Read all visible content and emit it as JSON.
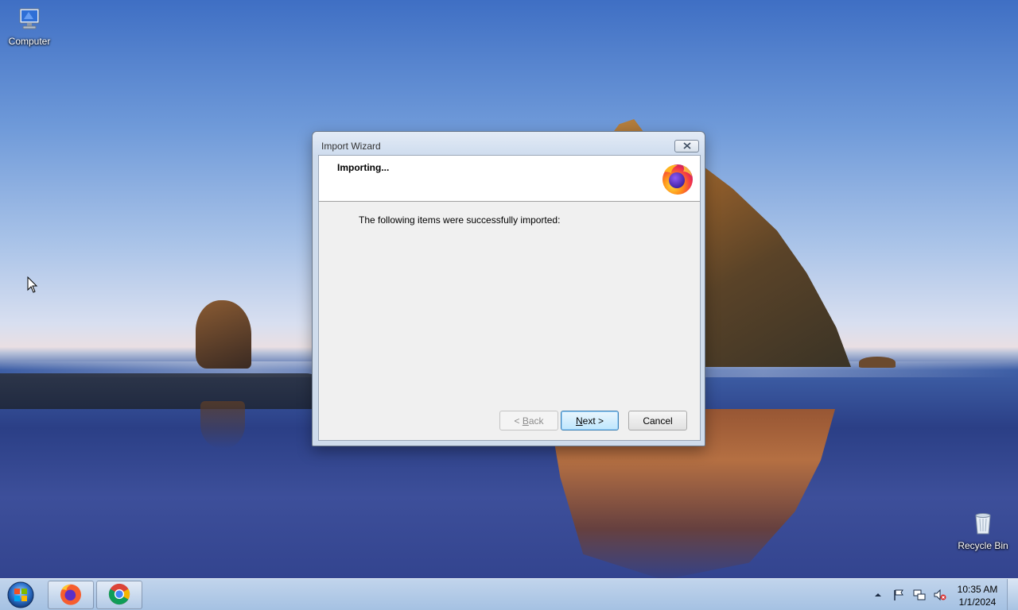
{
  "desktop": {
    "icons": [
      {
        "label": "Computer",
        "icon": "computer-icon"
      },
      {
        "label": "Recycle Bin",
        "icon": "recycle-bin-icon"
      }
    ]
  },
  "dialog": {
    "title": "Import Wizard",
    "heading": "Importing...",
    "body_text": "The following items were successfully imported:",
    "buttons": {
      "back": {
        "label": "< Back",
        "accel": "B",
        "prefix": "< ",
        "rest": "ack",
        "enabled": false
      },
      "next": {
        "label": "Next >",
        "accel": "N",
        "rest": "ext >"
      },
      "cancel": {
        "label": "Cancel"
      }
    },
    "logo_icon": "firefox-logo-icon"
  },
  "taskbar": {
    "pinned": [
      {
        "name": "Firefox",
        "icon": "firefox-icon"
      },
      {
        "name": "Google Chrome",
        "icon": "chrome-icon"
      }
    ],
    "tray_icons": [
      "show-hidden-icons-arrow",
      "action-center-flag-icon",
      "network-icon",
      "volume-muted-icon"
    ],
    "clock": {
      "time": "10:35 AM",
      "date": "1/1/2024"
    }
  },
  "colors": {
    "dialog_frame": "#cfdcec",
    "dialog_client": "#f0f0f0",
    "default_button_border": "#3c7fb1"
  }
}
